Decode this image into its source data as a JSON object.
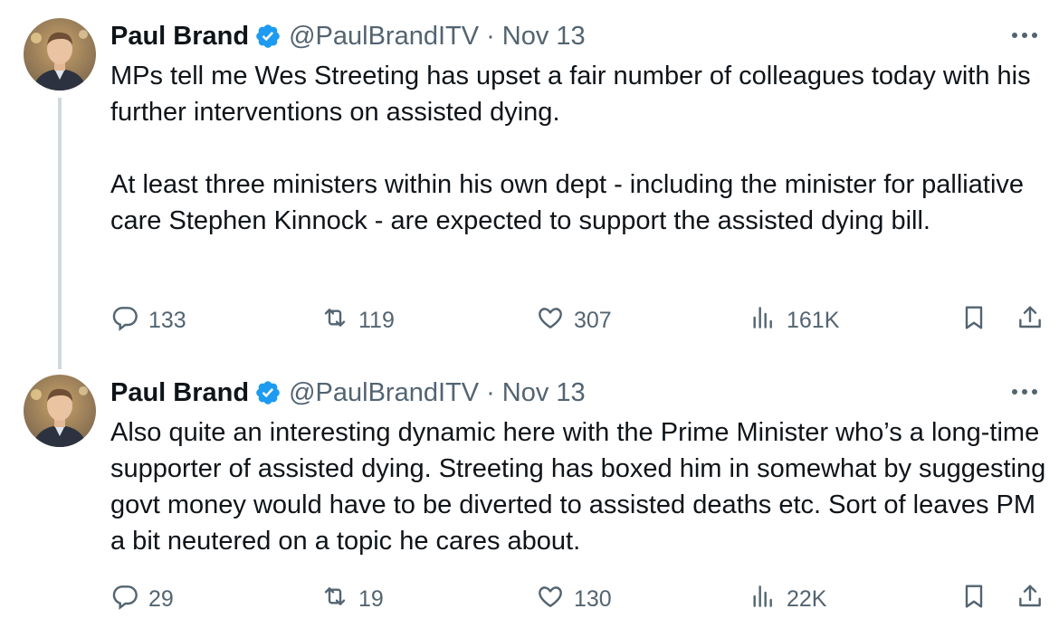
{
  "tweets": [
    {
      "author": {
        "name": "Paul Brand",
        "handle": "@PaulBrandITV",
        "date": "Nov 13",
        "verified": true
      },
      "text": "MPs tell me Wes Streeting has upset a fair number of colleagues today with his further interventions on assisted dying.\n\nAt least three ministers within his own dept - including the minister for palliative care Stephen Kinnock - are expected to support the assisted dying bill.",
      "stats": {
        "replies": "133",
        "reposts": "119",
        "likes": "307",
        "views": "161K"
      }
    },
    {
      "author": {
        "name": "Paul Brand",
        "handle": "@PaulBrandITV",
        "date": "Nov 13",
        "verified": true
      },
      "text": "Also quite an interesting dynamic here with the Prime Minister who’s a long-time supporter of assisted dying. Streeting has boxed him in somewhat by suggesting govt money would have to be diverted to assisted deaths etc. Sort of leaves PM a bit neutered on a topic he cares about.",
      "stats": {
        "replies": "29",
        "reposts": "19",
        "likes": "130",
        "views": "22K"
      }
    }
  ],
  "separator": "·",
  "colors": {
    "verified": "#1d9bf0",
    "muted": "#536471",
    "text": "#0f1419",
    "thread_line": "#cfd9de"
  },
  "icons": [
    "verified-badge-icon",
    "more-options-icon",
    "reply-icon",
    "repost-icon",
    "like-icon",
    "views-icon",
    "bookmark-icon",
    "share-icon"
  ]
}
